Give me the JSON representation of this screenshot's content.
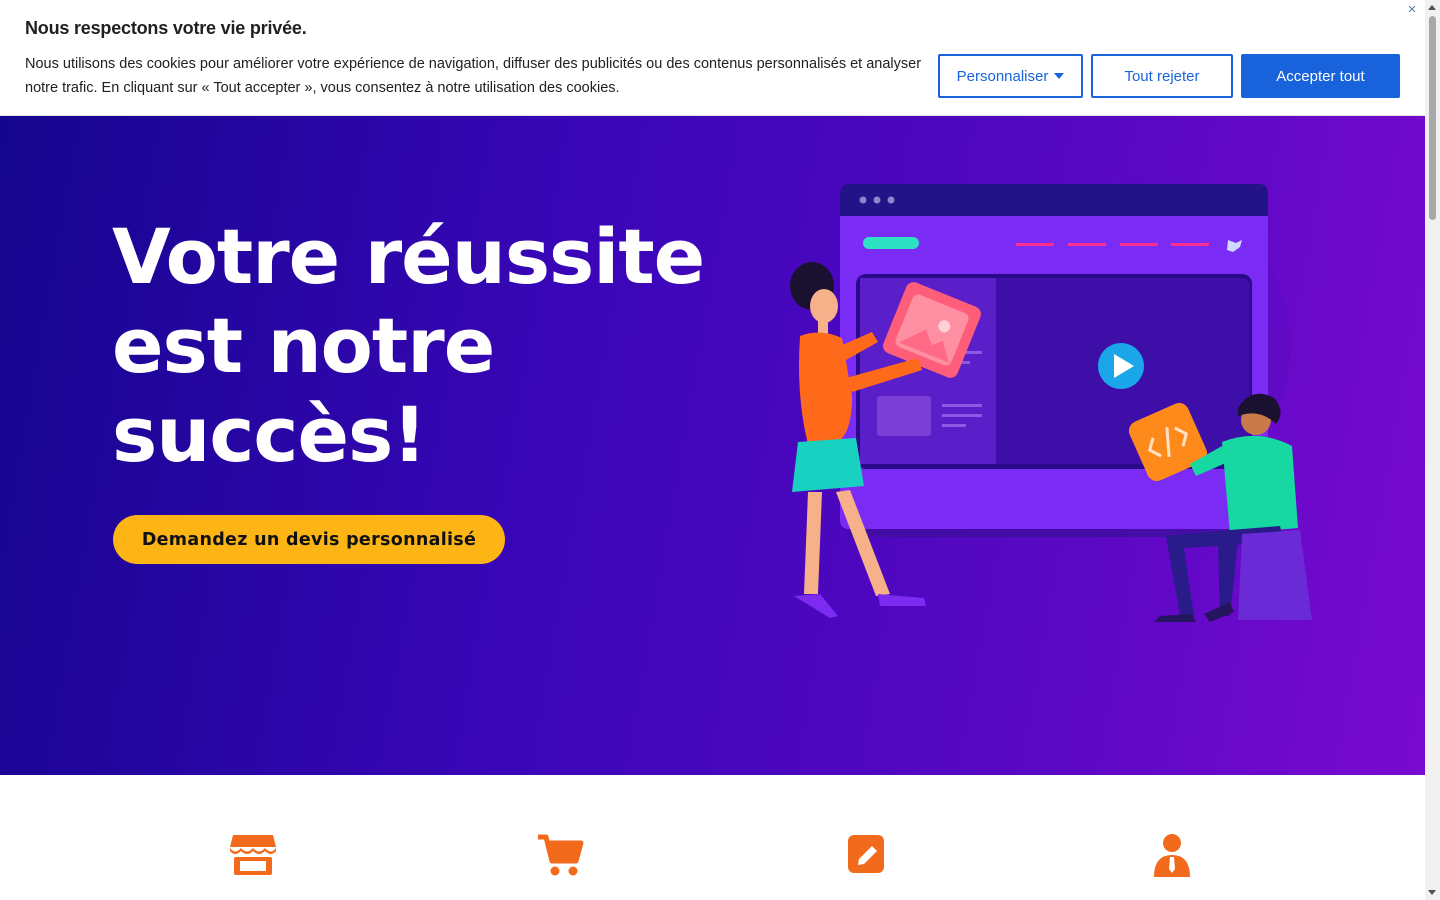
{
  "cookie_banner": {
    "title": "Nous respectons votre vie privée.",
    "text": "Nous utilisons des cookies pour améliorer votre expérience de navigation, diffuser des publicités ou des contenus personnalisés et analyser notre trafic. En cliquant sur « Tout accepter », vous consentez à notre utilisation des cookies.",
    "customize_label": "Personnaliser",
    "reject_label": "Tout rejeter",
    "accept_label": "Accepter tout",
    "close_symbol": "×",
    "accent_color": "#1863dc"
  },
  "hero": {
    "title": "Votre réussite est notre succès!",
    "cta_label": "Demandez un devis personnalisé",
    "cta_color": "#fdb515",
    "gradient": [
      "#15058e",
      "#7a0ad0"
    ]
  },
  "features": {
    "icon_color": "#f26a1b",
    "items": [
      {
        "icon": "store-icon"
      },
      {
        "icon": "cart-icon"
      },
      {
        "icon": "edit-icon"
      },
      {
        "icon": "user-tie-icon"
      }
    ]
  }
}
